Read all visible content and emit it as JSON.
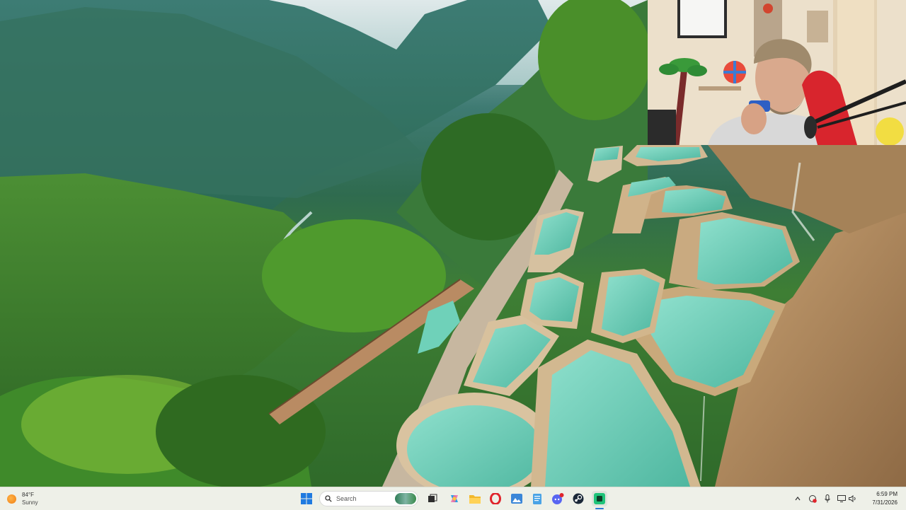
{
  "taskbar": {
    "weather": {
      "temperature": "84°F",
      "condition": "Sunny"
    },
    "search": {
      "label": "Search"
    },
    "clock": {
      "time": "6:59 PM",
      "date": "7/31/2026"
    },
    "pinned_apps": [
      "start-icon",
      "search-icon",
      "task-view-icon",
      "copilot-icon",
      "file-explorer-icon",
      "opera-icon",
      "photos-icon",
      "notepad-icon",
      "discord-icon",
      "steam-icon",
      "app-icon"
    ],
    "tray_icons": [
      "chevron-up-icon",
      "network-warning-icon",
      "microphone-icon",
      "display-icon",
      "volume-icon"
    ]
  },
  "colors": {
    "taskbar_bg": "#eef0e8",
    "pool_water": "#6fd1b9",
    "accent_red": "#e0242c"
  }
}
